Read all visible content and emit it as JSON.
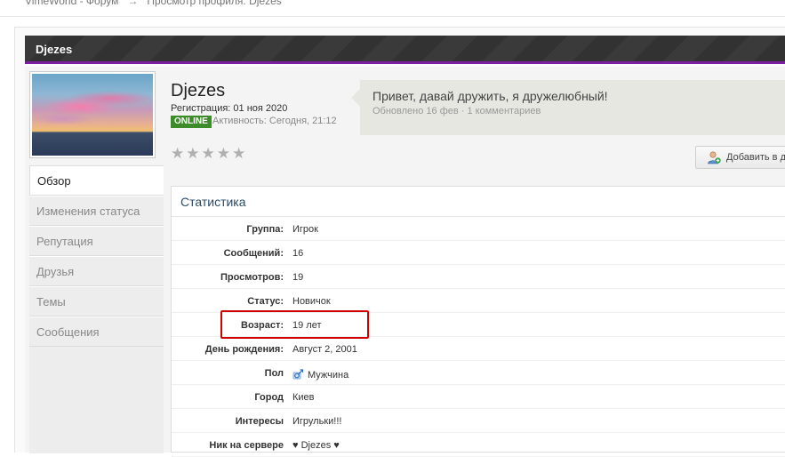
{
  "breadcrumb": {
    "home": "VimeWorld - Форум",
    "separator": "→",
    "current": "Просмотр профиля: Djezes"
  },
  "header": {
    "title": "Djezes"
  },
  "profile": {
    "name": "Djezes",
    "registration": "Регистрация: 01 ноя 2020",
    "online_badge": "ONLINE",
    "activity": "Активность: Сегодня, 21:12",
    "rating_stars": 0
  },
  "status": {
    "message": "Привет, давай дружить, я дружелюбный!",
    "meta": "Обновлено 16 фев · 1 комментариев"
  },
  "add_friend_label": "Добавить в друзья",
  "side_nav": [
    {
      "label": "Обзор",
      "active": true
    },
    {
      "label": "Изменения статуса"
    },
    {
      "label": "Репутация"
    },
    {
      "label": "Друзья"
    },
    {
      "label": "Темы"
    },
    {
      "label": "Сообщения"
    }
  ],
  "stats": {
    "heading": "Статистика",
    "rows": [
      {
        "label": "Группа:",
        "value": "Игрок"
      },
      {
        "label": "Сообщений:",
        "value": "16"
      },
      {
        "label": "Просмотров:",
        "value": "19"
      },
      {
        "label": "Статус:",
        "value": "Новичок"
      },
      {
        "label": "Возраст:",
        "value": "19 лет"
      },
      {
        "label": "День рождения:",
        "value": "Август 2, 2001"
      },
      {
        "label": "Пол",
        "value": "Мужчина"
      },
      {
        "label": "Город",
        "value": "Киев"
      },
      {
        "label": "Интересы",
        "value": "Игрульки!!!"
      },
      {
        "label": "Ник на сервере",
        "value": "♥ Djezes ♥"
      }
    ]
  },
  "colors": {
    "accent_purple": "#7a1fa2",
    "online_green": "#3d8c2a",
    "highlight_red": "#d00000"
  },
  "icons": {
    "male": "male-gender-icon",
    "add_friend": "add-user-icon",
    "star": "rating-star-icon"
  }
}
